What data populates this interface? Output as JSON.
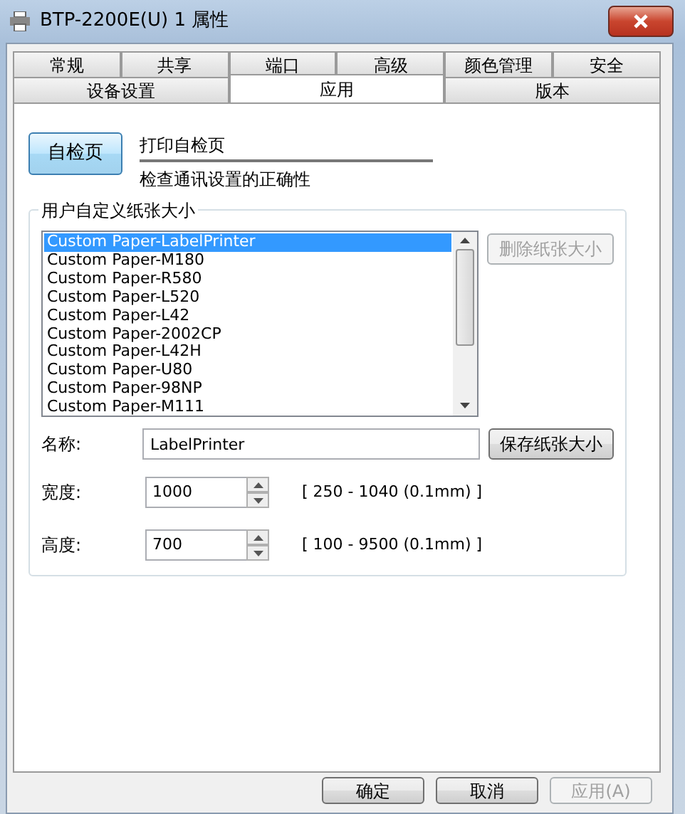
{
  "window": {
    "title": "BTP-2200E(U) 1 属性"
  },
  "tab_rows": [
    [
      {
        "label": "常规",
        "selected": false
      },
      {
        "label": "共享",
        "selected": false
      },
      {
        "label": "端口",
        "selected": false
      },
      {
        "label": "高级",
        "selected": false
      },
      {
        "label": "颜色管理",
        "selected": false
      },
      {
        "label": "安全",
        "selected": false
      }
    ],
    [
      {
        "label": "设备设置",
        "selected": false
      },
      {
        "label": "应用",
        "selected": true
      },
      {
        "label": "版本",
        "selected": false
      }
    ]
  ],
  "self_test": {
    "button": "自检页",
    "title": "打印自检页",
    "description": "检查通讯设置的正确性"
  },
  "paper_group": {
    "legend": "用户自定义纸张大小",
    "papers": [
      {
        "label": "Custom Paper-LabelPrinter",
        "selected": true
      },
      {
        "label": "Custom Paper-M180",
        "selected": false
      },
      {
        "label": "Custom Paper-R580",
        "selected": false
      },
      {
        "label": "Custom Paper-L520",
        "selected": false
      },
      {
        "label": "Custom Paper-L42",
        "selected": false
      },
      {
        "label": "Custom Paper-2002CP",
        "selected": false
      },
      {
        "label": "Custom Paper-L42H",
        "selected": false
      },
      {
        "label": "Custom Paper-U80",
        "selected": false
      },
      {
        "label": "Custom Paper-98NP",
        "selected": false
      },
      {
        "label": "Custom Paper-M111",
        "selected": false
      }
    ],
    "delete_button": {
      "label": "删除纸张大小",
      "disabled": true
    },
    "name": {
      "label": "名称:",
      "value": "LabelPrinter"
    },
    "save_button": {
      "label": "保存纸张大小",
      "disabled": false
    },
    "width": {
      "label": "宽度:",
      "value": "1000",
      "range": "[ 250 - 1040 (0.1mm) ]"
    },
    "height": {
      "label": "高度:",
      "value": "700",
      "range": "[ 100 - 9500 (0.1mm) ]"
    }
  },
  "buttons": [
    {
      "label": "确定",
      "disabled": false
    },
    {
      "label": "取消",
      "disabled": false
    },
    {
      "label": "应用(A)",
      "disabled": true
    }
  ]
}
